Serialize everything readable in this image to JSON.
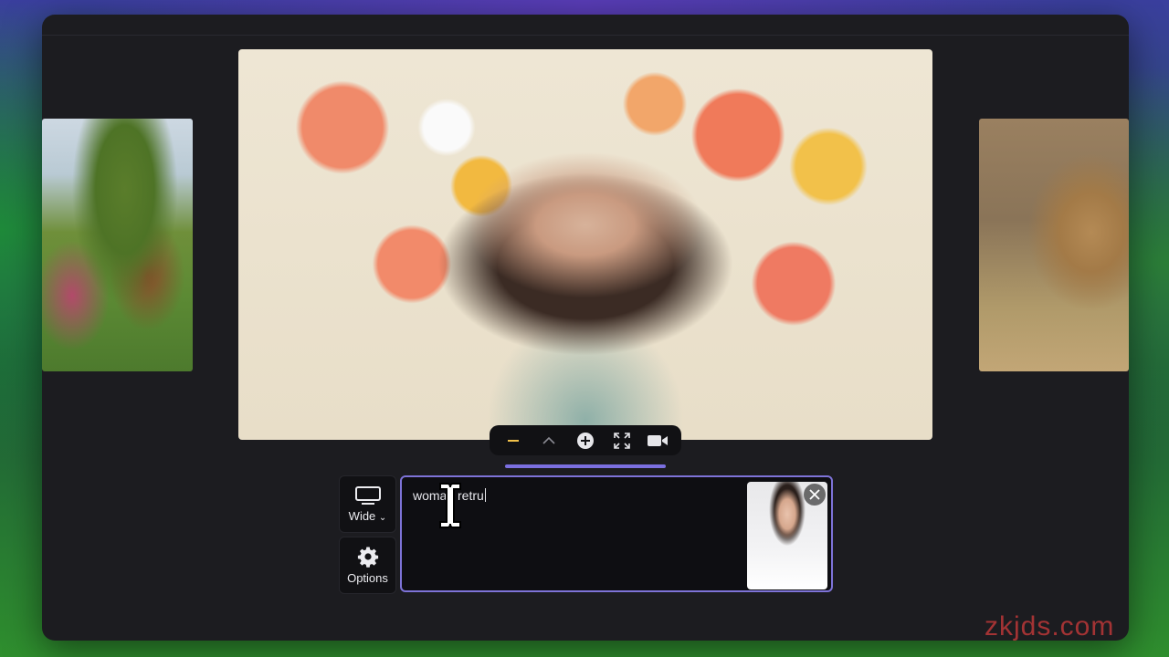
{
  "gallery": {
    "main_image_alt": "woman smiling surrounded by flowers",
    "left_thumbnail_alt": "pastoral painting with trees and figures",
    "right_thumbnail_alt": "lion in dry grass"
  },
  "toolbar": {
    "icons": [
      "minus-icon",
      "chevron-up-icon",
      "plus-circle-icon",
      "fullscreen-icon",
      "video-camera-icon"
    ],
    "active_accent": "#f2c14a"
  },
  "side_controls": {
    "aspect_label": "Wide",
    "aspect_chevron": "⌄",
    "options_label": "Options"
  },
  "prompt": {
    "value": "woman retru"
  },
  "colors": {
    "accent": "#7e73d8",
    "window_bg": "#1c1c20"
  },
  "watermark": "zkjds.com"
}
